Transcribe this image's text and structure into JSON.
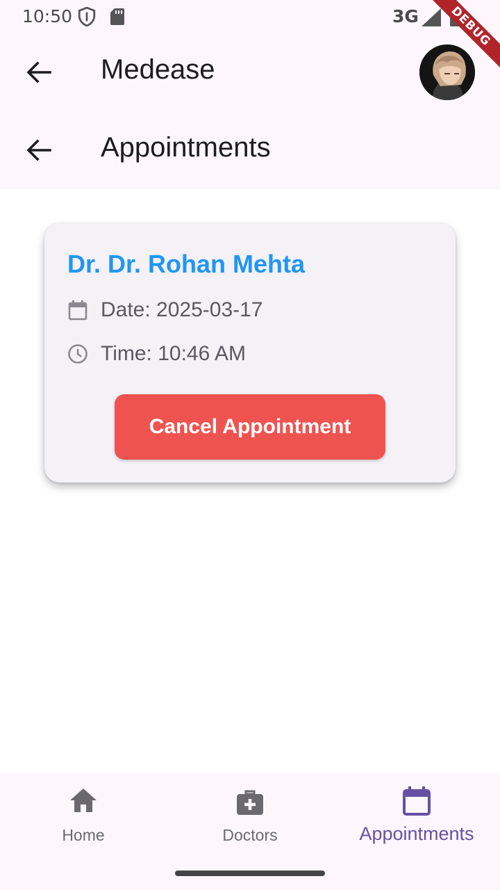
{
  "status_bar": {
    "time": "10:50",
    "network": "3G",
    "icons": [
      "shield-icon",
      "sd-card-icon",
      "signal-icon",
      "battery-icon"
    ]
  },
  "debug_banner": "DEBUG",
  "top_bar": {
    "title": "Medease",
    "back_icon": "arrow-back-icon",
    "avatar": "user-avatar"
  },
  "sub_bar": {
    "title": "Appointments",
    "back_icon": "arrow-back-icon"
  },
  "appointment": {
    "doctor_name": "Dr. Dr. Rohan Mehta",
    "date_text": "Date: 2025-03-17",
    "time_text": "Time: 10:46 AM",
    "cancel_label": "Cancel Appointment",
    "date_icon": "calendar-icon",
    "time_icon": "clock-icon"
  },
  "bottom_nav": {
    "items": [
      {
        "label": "Home",
        "icon": "home-icon",
        "active": false
      },
      {
        "label": "Doctors",
        "icon": "medical-bag-icon",
        "active": false
      },
      {
        "label": "Appointments",
        "icon": "calendar-icon",
        "active": true
      }
    ]
  },
  "colors": {
    "accent": "#6750a4",
    "doctor_name": "#2196f3",
    "cancel_button": "#ef5350",
    "bar_background": "#fdf7fd",
    "card_background": "#f4f1f7"
  }
}
